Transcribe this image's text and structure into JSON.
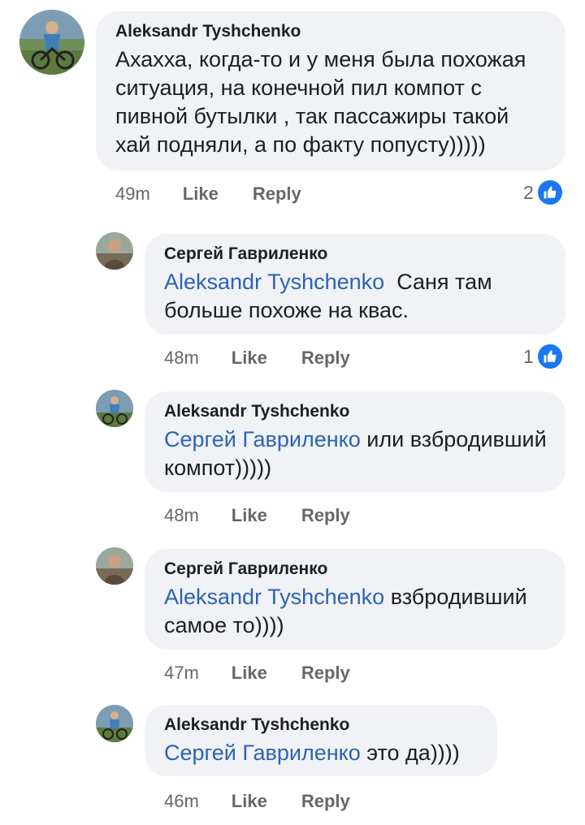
{
  "comments": [
    {
      "author": "Aleksandr Tyshchenko",
      "mention": "",
      "text": "Ахахха, когда-то и у меня была похожая ситуация, на конечной пил компот с пивной бутылки , так пассажиры такой хай подняли, а по факту попусту)))))",
      "time": "49m",
      "like": "Like",
      "reply": "Reply",
      "reaction_count": "2"
    },
    {
      "author": "Сергей Гавриленко",
      "mention": "Aleksandr Tyshchenko",
      "text": "Саня там больше похоже на квас.",
      "time": "48m",
      "like": "Like",
      "reply": "Reply",
      "reaction_count": "1"
    },
    {
      "author": "Aleksandr Tyshchenko",
      "mention": "Сергей Гавриленко",
      "text": "или взбродивший компот)))))",
      "time": "48m",
      "like": "Like",
      "reply": "Reply",
      "reaction_count": ""
    },
    {
      "author": "Сергей Гавриленко",
      "mention": "Aleksandr Tyshchenko",
      "text": "взбродивший самое то))))",
      "time": "47m",
      "like": "Like",
      "reply": "Reply",
      "reaction_count": ""
    },
    {
      "author": "Aleksandr Tyshchenko",
      "mention": "Сергей Гавриленко",
      "text": "это да))))",
      "time": "46m",
      "like": "Like",
      "reply": "Reply",
      "reaction_count": ""
    }
  ],
  "icons": {
    "like_badge": "thumbs-up-icon",
    "avatar_aleksandr": "cyclist-photo",
    "avatar_sergei": "person-photo"
  },
  "colors": {
    "bubble": "#f0f2f5",
    "mention": "#2b63b6",
    "meta": "#65676b",
    "like_badge": "#1877f2"
  }
}
